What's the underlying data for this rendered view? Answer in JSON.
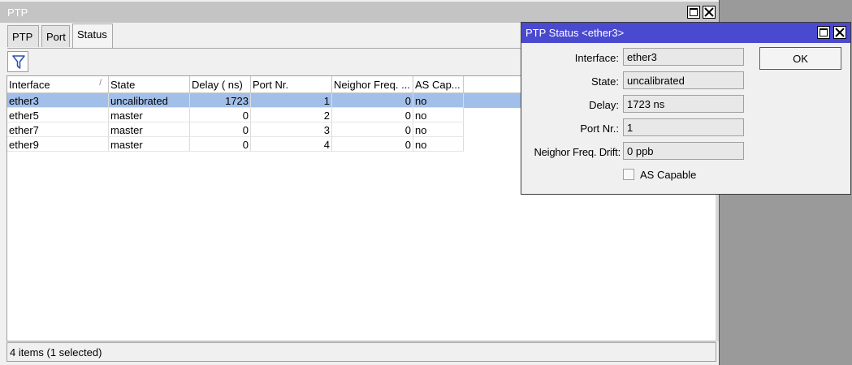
{
  "main_window": {
    "title": "PTP",
    "tabs": [
      {
        "label": "PTP",
        "active": false
      },
      {
        "label": "Port",
        "active": false
      },
      {
        "label": "Status",
        "active": true
      }
    ],
    "toolbar": {
      "filter_icon": "filter-funnel-icon"
    },
    "table": {
      "columns": [
        "Interface",
        "State",
        "Delay ( ns)",
        "Port Nr.",
        "Neighor Freq. ...",
        "AS Cap..."
      ],
      "sort_indicator": "/",
      "rows": [
        {
          "interface": "ether3",
          "state": "uncalibrated",
          "delay": "1723",
          "port_nr": "1",
          "neighbor_freq": "0",
          "as_capable": "no",
          "selected": true
        },
        {
          "interface": "ether5",
          "state": "master",
          "delay": "0",
          "port_nr": "2",
          "neighbor_freq": "0",
          "as_capable": "no",
          "selected": false
        },
        {
          "interface": "ether7",
          "state": "master",
          "delay": "0",
          "port_nr": "3",
          "neighbor_freq": "0",
          "as_capable": "no",
          "selected": false
        },
        {
          "interface": "ether9",
          "state": "master",
          "delay": "0",
          "port_nr": "4",
          "neighbor_freq": "0",
          "as_capable": "no",
          "selected": false
        }
      ]
    },
    "status_text": "4 items (1 selected)"
  },
  "dialog": {
    "title": "PTP Status <ether3>",
    "ok_label": "OK",
    "fields": [
      {
        "label": "Interface:",
        "value": "ether3"
      },
      {
        "label": "State:",
        "value": "uncalibrated"
      },
      {
        "label": "Delay:",
        "value": "1723  ns"
      },
      {
        "label": "Port Nr.:",
        "value": "1"
      },
      {
        "label": "Neighor Freq. Drift:",
        "value": "0  ppb"
      }
    ],
    "checkbox_label": "AS Capable",
    "checkbox_checked": false
  },
  "colors": {
    "dialog_title_bg": "#4a4ad0",
    "main_title_bg": "#c4c4c4",
    "selection_bg": "#a2bfe9"
  }
}
